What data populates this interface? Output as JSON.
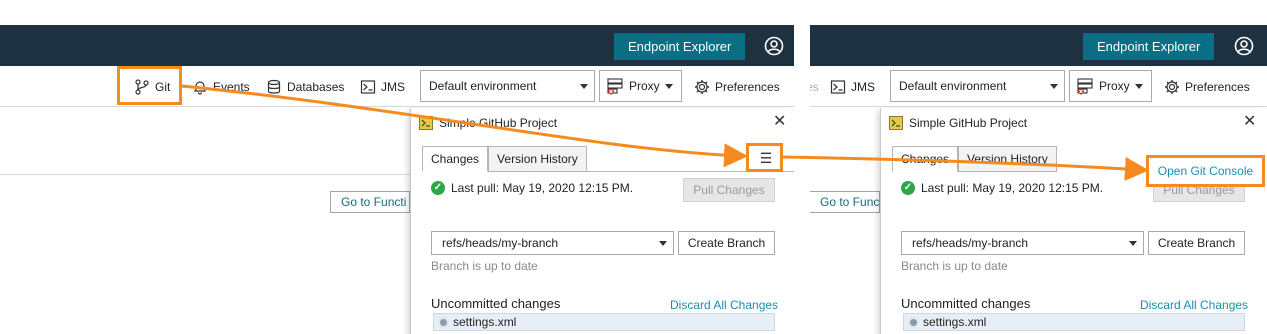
{
  "endpoint_explorer_label": "Endpoint Explorer",
  "toolbar": {
    "git": "Git",
    "events": "Events",
    "databases": "Databases",
    "jms": "JMS",
    "events_fragment": "es",
    "environment": "Default environment",
    "proxy": "Proxy",
    "preferences": "Preferences"
  },
  "go_to_function": "Go to Functi",
  "panel": {
    "title": "Simple GitHub Project",
    "close": "✕",
    "tabs": [
      "Changes",
      "Version History"
    ],
    "menu_icon": "☰",
    "last_pull": "Last pull: May 19, 2020 12:15 PM.",
    "pull_button": "Pull Changes",
    "branch": "refs/heads/my-branch",
    "create_branch": "Create Branch",
    "branch_status": "Branch is up to date",
    "uncommitted": "Uncommitted changes",
    "discard": "Discard All Changes",
    "file": "settings.xml"
  },
  "popup": {
    "open_git_console": "Open Git Console"
  },
  "colors": {
    "topbar": "#1e3140",
    "endpoint_button": "#0a6f84",
    "highlight": "#f58a1f",
    "link": "#1a8fb0",
    "success": "#2ea64a"
  },
  "icons": [
    "git-branch-icon",
    "bell-icon",
    "database-icon",
    "jms-icon",
    "proxy-icon",
    "gear-icon",
    "user-icon",
    "check-circle-icon",
    "menu-icon",
    "close-icon",
    "project-icon",
    "file-icon"
  ]
}
